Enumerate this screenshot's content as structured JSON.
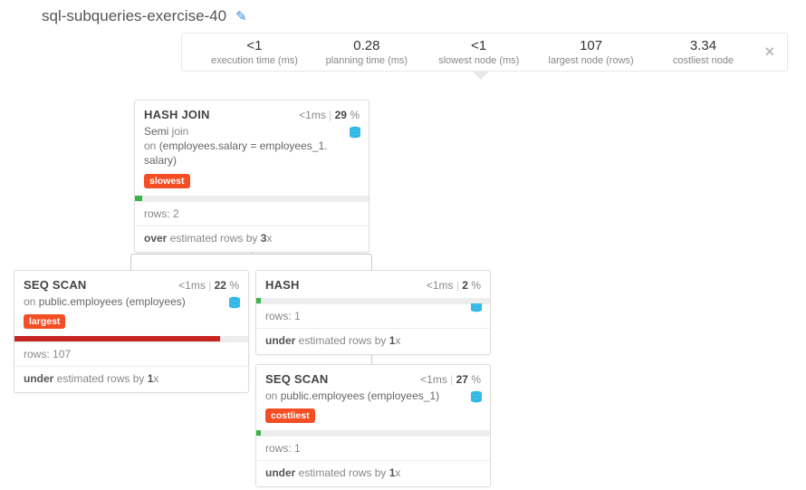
{
  "title": "sql-subqueries-exercise-40",
  "stats": {
    "exec_val": "<1",
    "exec_lbl": "execution time (ms)",
    "plan_val": "0.28",
    "plan_lbl": "planning time (ms)",
    "slow_val": "<1",
    "slow_lbl": "slowest node (ms)",
    "large_val": "107",
    "large_lbl": "largest node (rows)",
    "cost_val": "3.34",
    "cost_lbl": "costliest node"
  },
  "hashjoin": {
    "title": "HASH JOIN",
    "ms": "<1ms",
    "pct": "29",
    "desc_prefix": "Semi",
    "desc_join": " join",
    "desc_on": "on ",
    "desc_cond": "(employees.salary = employees_1. salary)",
    "tag": "slowest",
    "rows_lbl": "rows: ",
    "rows": "2",
    "est_word": "over",
    "est_mid": " estimated rows by ",
    "est_factor": "3",
    "est_x": "x"
  },
  "seqscan1": {
    "title": "SEQ SCAN",
    "ms": "<1ms",
    "pct": "22",
    "on_lbl": "on ",
    "on_target": "public.employees (employees)",
    "tag": "largest",
    "rows_lbl": "rows: ",
    "rows": "107",
    "est_word": "under",
    "est_mid": " estimated rows by ",
    "est_factor": "1",
    "est_x": "x"
  },
  "hash": {
    "title": "HASH",
    "ms": "<1ms",
    "pct": "2",
    "rows_lbl": "rows: ",
    "rows": "1",
    "est_word": "under",
    "est_mid": " estimated rows by ",
    "est_factor": "1",
    "est_x": "x"
  },
  "seqscan2": {
    "title": "SEQ SCAN",
    "ms": "<1ms",
    "pct": "27",
    "on_lbl": "on ",
    "on_target": "public.employees (employees_1)",
    "tag": "costliest",
    "rows_lbl": "rows: ",
    "rows": "1",
    "est_word": "under",
    "est_mid": " estimated rows by ",
    "est_factor": "1",
    "est_x": "x"
  }
}
